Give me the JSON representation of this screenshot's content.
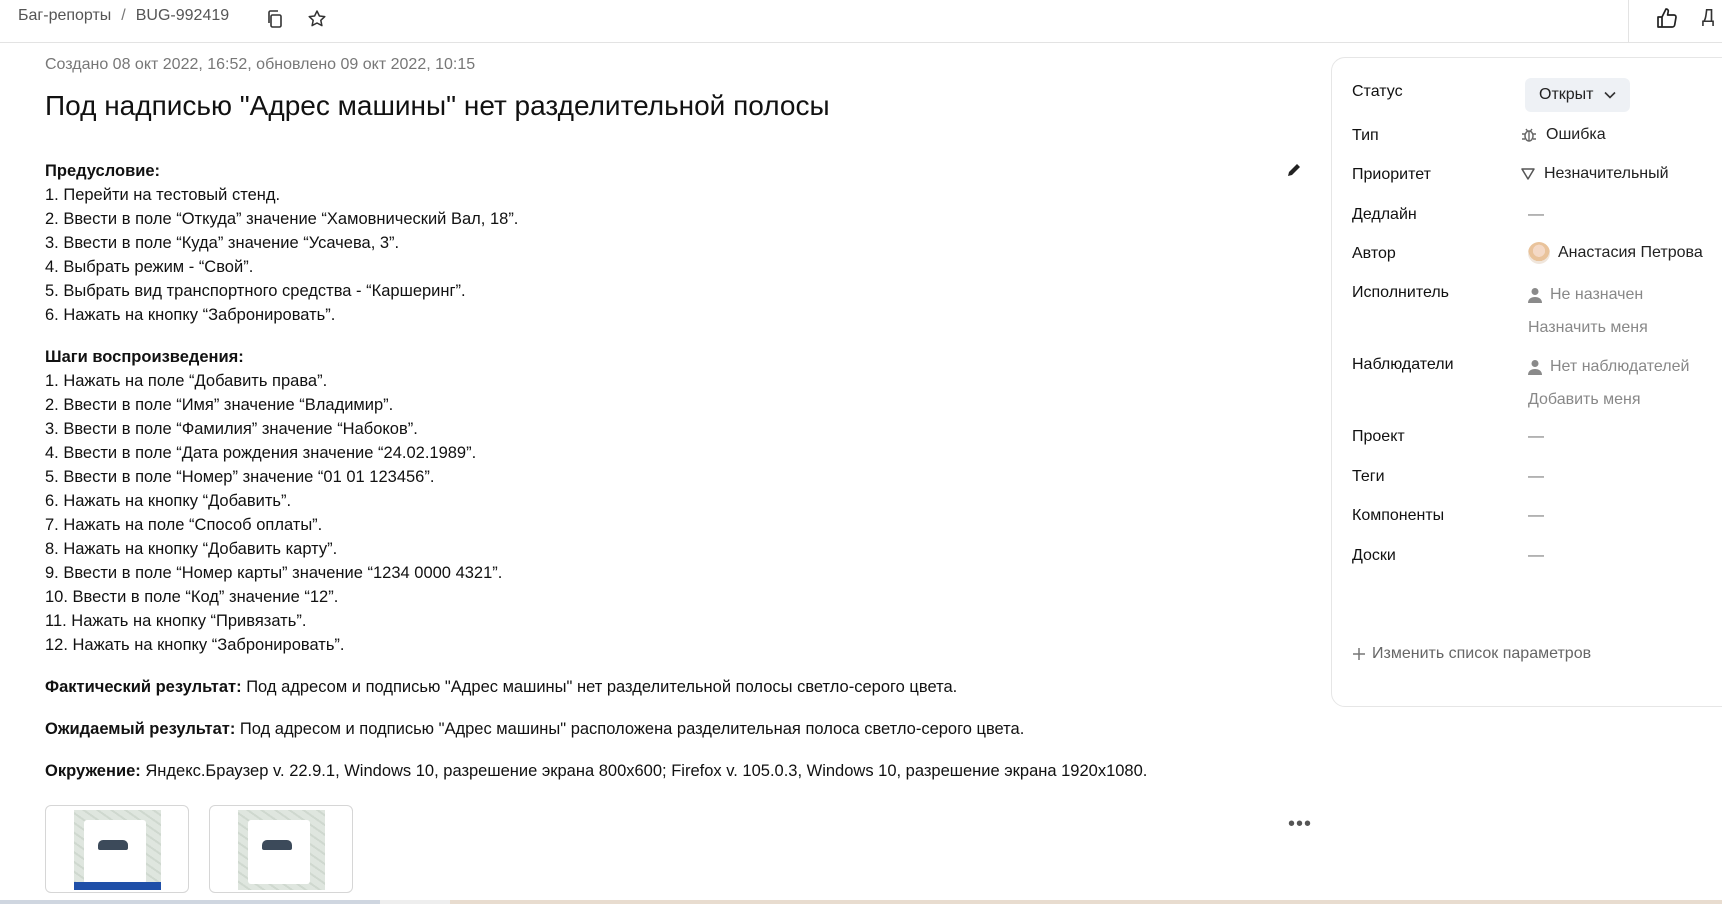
{
  "breadcrumb": {
    "section": "Баг-репорты",
    "separator": "/",
    "issue_key": "BUG-992419"
  },
  "topbar": {
    "cut_label": "Д"
  },
  "issue": {
    "meta": "Создано 08 окт 2022, 16:52, обновлено 09 окт 2022, 10:15",
    "title": "Под надписью \"Адрес машины\" нет разделительной полосы",
    "precondition_heading": "Предусловие:",
    "precondition_steps": [
      "1. Перейти на тестовый стенд.",
      "2. Ввести в поле “Откуда” значение “Хамовнический Вал, 18”.",
      "3. Ввести в поле “Куда” значение “Усачева, 3”.",
      "4. Выбрать режим - “Свой”.",
      "5. Выбрать вид транспортного средства - “Каршеринг”.",
      "6. Нажать на кнопку “Забронировать”."
    ],
    "steps_heading": "Шаги воспроизведения:",
    "steps": [
      "1. Нажать на поле “Добавить права”.",
      "2. Ввести в поле “Имя” значение “Владимир”.",
      "3. Ввести в поле “Фамилия” значение “Набоков”.",
      "4. Ввести в поле “Дата рождения значение “24.02.1989”.",
      "5. Ввести в поле “Номер” значение “01 01 123456”.",
      "6. Нажать на кнопку “Добавить”.",
      "7. Нажать на поле “Способ оплаты”.",
      "8. Нажать на кнопку “Добавить карту”.",
      "9. Ввести в поле “Номер карты” значение “1234 0000 4321”.",
      "10. Ввести в поле “Код” значение “12”.",
      "11. Нажать на кнопку “Привязать”.",
      "12. Нажать на кнопку “Забронировать”."
    ],
    "actual_label": "Фактический результат:",
    "actual_text": " Под адресом и подписью \"Адрес машины\" нет разделительной полосы светло-серого цвета.",
    "expected_label": "Ожидаемый результат:",
    "expected_text": " Под адресом и подписью \"Адрес машины\" расположена разделительная полоса светло-серого цвета.",
    "env_label": "Окружение:",
    "env_text": " Яндекс.Браузер v. 22.9.1, Windows 10, разрешение экрана 800x600; Firefox v. 105.0.3, Windows 10, разрешение экрана 1920x1080."
  },
  "attachments": [
    {
      "icon": "screenshot-thumbnail"
    },
    {
      "icon": "screenshot-thumbnail"
    }
  ],
  "more_label": "•••",
  "sidebar": {
    "status_label": "Статус",
    "status_value": "Открыт",
    "type_label": "Тип",
    "type_value": "Ошибка",
    "priority_label": "Приоритет",
    "priority_value": "Незначительный",
    "deadline_label": "Дедлайн",
    "deadline_value": "—",
    "author_label": "Автор",
    "author_value": "Анастасия Петрова",
    "assignee_label": "Исполнитель",
    "assignee_value": "Не назначен",
    "assign_me": "Назначить меня",
    "watchers_label": "Наблюдатели",
    "watchers_value": "Нет наблюдателей",
    "add_me": "Добавить меня",
    "project_label": "Проект",
    "project_value": "—",
    "tags_label": "Теги",
    "tags_value": "—",
    "components_label": "Компоненты",
    "components_value": "—",
    "boards_label": "Доски",
    "boards_value": "—",
    "change_params": "Изменить список параметров"
  },
  "colors": {
    "status_bg": "#eef1f5",
    "border": "#e6e6e6",
    "muted": "#888888"
  }
}
